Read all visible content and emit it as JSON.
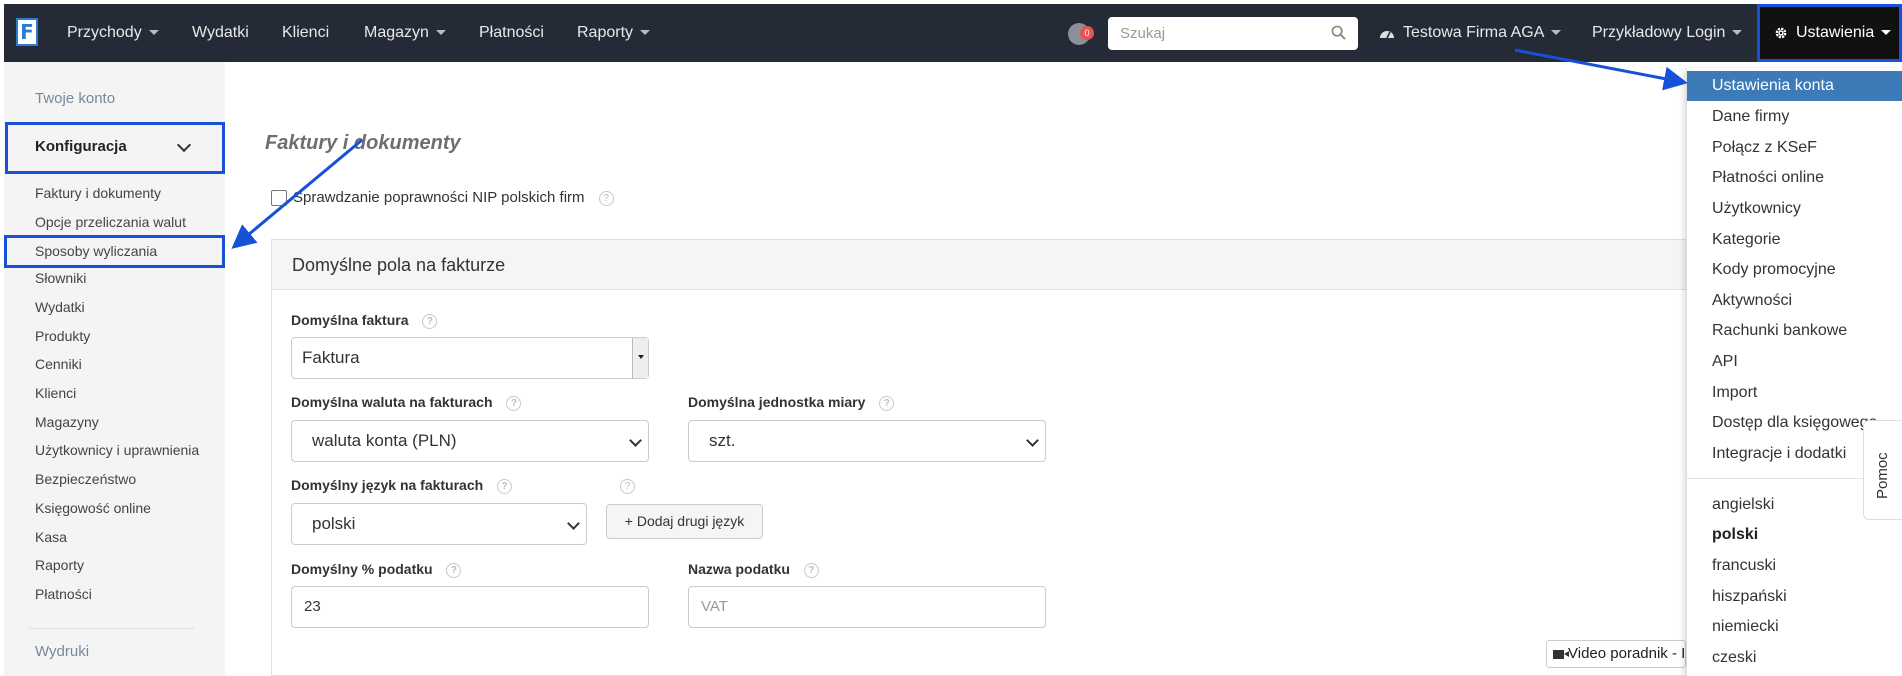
{
  "navbar": {
    "logo": "F",
    "menu": [
      {
        "label": "Przychody",
        "dropdown": true
      },
      {
        "label": "Wydatki",
        "dropdown": false
      },
      {
        "label": "Klienci",
        "dropdown": false
      },
      {
        "label": "Magazyn",
        "dropdown": true
      },
      {
        "label": "Płatności",
        "dropdown": false
      },
      {
        "label": "Raporty",
        "dropdown": true
      }
    ],
    "notification_count": "0",
    "search_placeholder": "Szukaj",
    "company": "Testowa Firma AGA",
    "login": "Przykładowy Login",
    "settings": "Ustawienia"
  },
  "sidebar": {
    "account": "Twoje konto",
    "section": "Konfiguracja",
    "items": [
      "Faktury i dokumenty",
      "Opcje przeliczania walut",
      "Sposoby wyliczania",
      "Słowniki",
      "Wydatki",
      "Produkty",
      "Cenniki",
      "Klienci",
      "Magazyny",
      "Użytkownicy i uprawnienia",
      "Bezpieczeństwo",
      "Księgowość online",
      "Kasa",
      "Raporty",
      "Płatności"
    ],
    "prints": "Wydruki"
  },
  "main": {
    "title": "Faktury i dokumenty",
    "nip_check": "Sprawdzanie poprawności NIP polskich firm",
    "panel_title": "Domyślne pola na fakturze",
    "default_invoice_label": "Domyślna faktura",
    "default_invoice_value": "Faktura",
    "currency_label": "Domyślna waluta na fakturach",
    "currency_value": "waluta konta (PLN)",
    "unit_label": "Domyślna jednostka miary",
    "unit_value": "szt.",
    "language_label": "Domyślny język na fakturach",
    "language_value": "polski",
    "add_language": "+ Dodaj drugi język",
    "tax_label": "Domyślny % podatku",
    "tax_value": "23",
    "tax_name_label": "Nazwa podatku",
    "tax_name_placeholder": "VAT",
    "video_button": "Video poradnik - I"
  },
  "settings_menu": {
    "items": [
      "Ustawienia konta",
      "Dane firmy",
      "Połącz z KSeF",
      "Płatności online",
      "Użytkownicy",
      "Kategorie",
      "Kody promocyjne",
      "Aktywności",
      "Rachunki bankowe",
      "API",
      "Import",
      "Dostęp dla księgowego",
      "Integracje i dodatki"
    ],
    "languages": [
      "angielski",
      "polski",
      "francuski",
      "hiszpański",
      "niemiecki",
      "czeski"
    ],
    "selected_language": "polski"
  },
  "help_tab": "Pomoc",
  "colors": {
    "navbar": "#252b36",
    "highlight_box": "#1651d8",
    "active_menu": "#3d7ab8"
  }
}
